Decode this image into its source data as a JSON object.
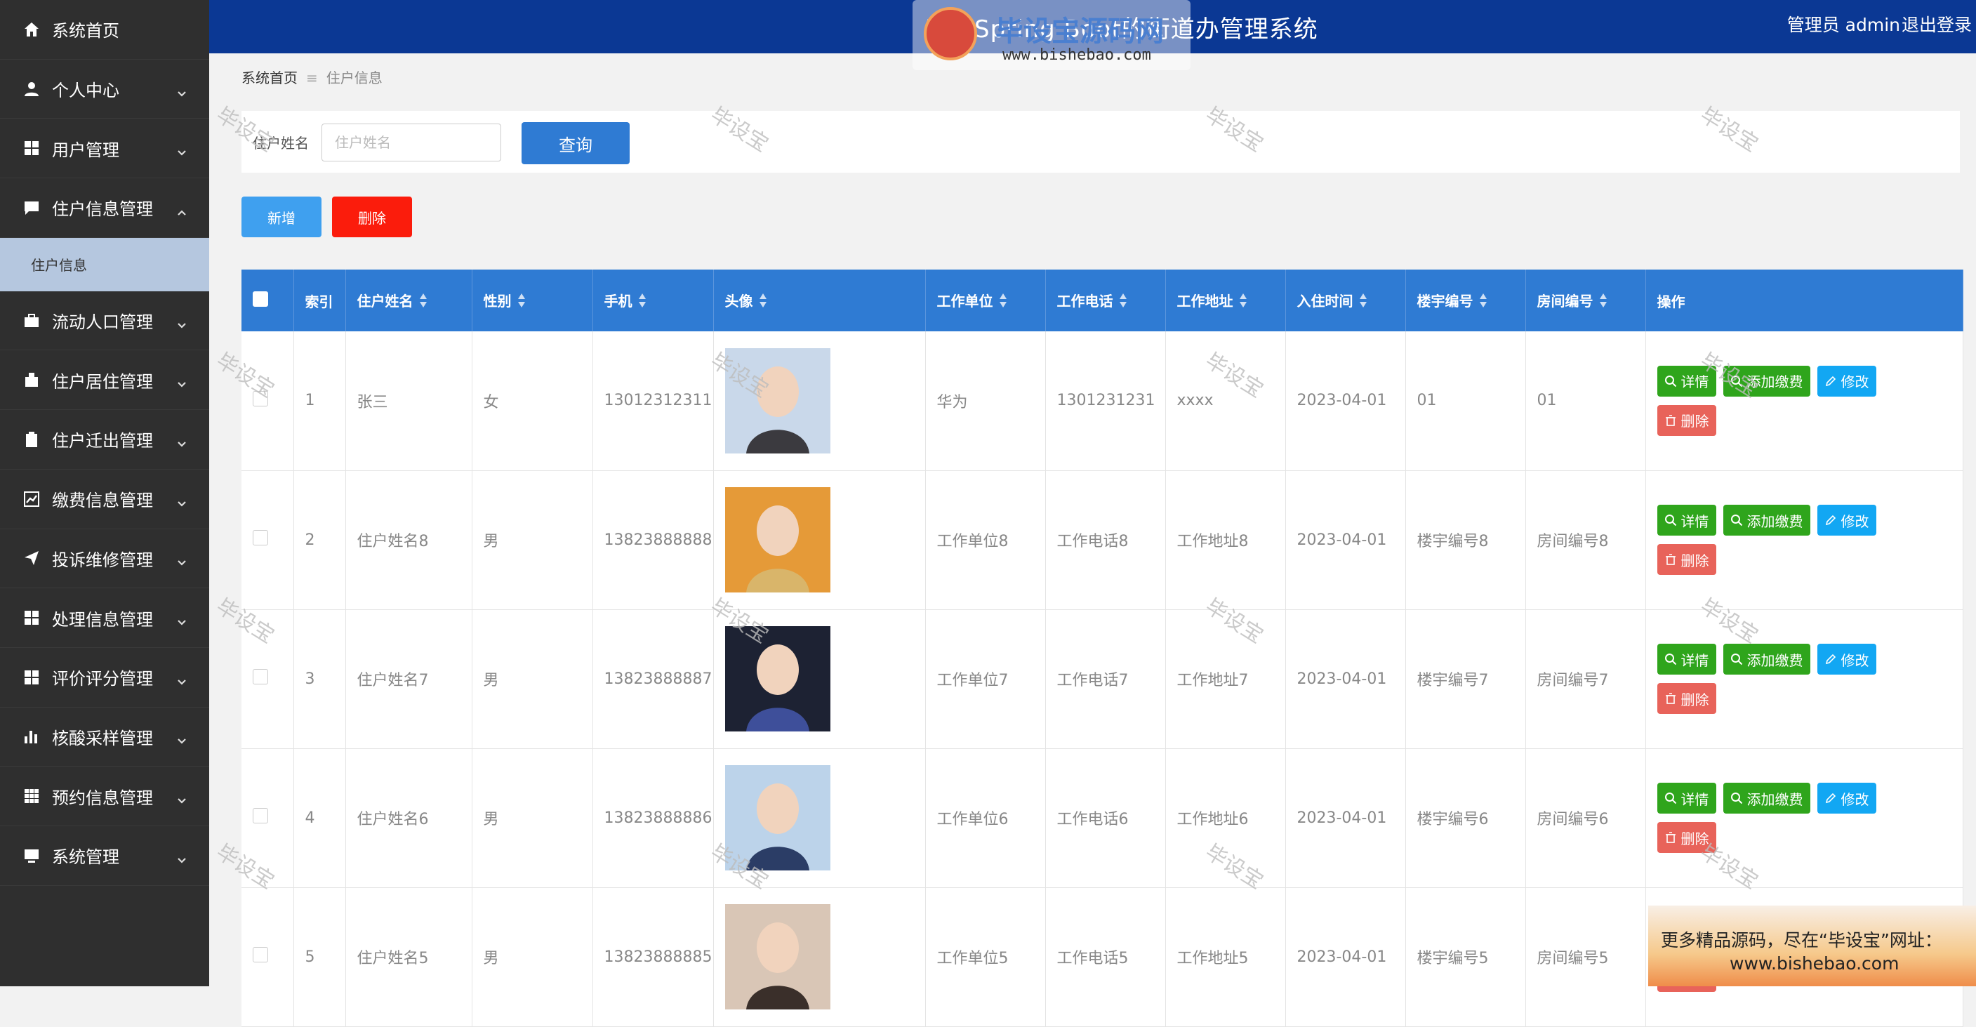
{
  "header": {
    "title": "基于Spring Boot的街道办管理系统",
    "admin": "管理员 admin",
    "logout": "退出登录",
    "logo_text": "毕设宝源码网",
    "logo_url": "www.bishebao.com"
  },
  "sidebar": {
    "items": [
      {
        "label": "系统首页",
        "icon": "home-icon"
      },
      {
        "label": "个人中心",
        "icon": "user-icon"
      },
      {
        "label": "用户管理",
        "icon": "grid-icon"
      },
      {
        "label": "住户信息管理",
        "icon": "chat-icon"
      },
      {
        "label": "流动人口管理",
        "icon": "briefcase-icon"
      },
      {
        "label": "住户居住管理",
        "icon": "bookmark-icon"
      },
      {
        "label": "住户迁出管理",
        "icon": "clipboard-icon"
      },
      {
        "label": "缴费信息管理",
        "icon": "chart-line-icon"
      },
      {
        "label": "投诉维修管理",
        "icon": "send-icon"
      },
      {
        "label": "处理信息管理",
        "icon": "grid-icon"
      },
      {
        "label": "评价评分管理",
        "icon": "grid-icon"
      },
      {
        "label": "核酸采样管理",
        "icon": "bar-chart-icon"
      },
      {
        "label": "预约信息管理",
        "icon": "table-icon"
      },
      {
        "label": "系统管理",
        "icon": "monitor-icon"
      }
    ],
    "sub_item": "住户信息"
  },
  "breadcrumb": {
    "home": "系统首页",
    "current": "住户信息"
  },
  "search": {
    "label": "住户姓名",
    "placeholder": "住户姓名",
    "button": "查询"
  },
  "actions": {
    "add": "新增",
    "delete": "删除"
  },
  "table": {
    "headers": [
      "索引",
      "住户姓名",
      "性别",
      "手机",
      "头像",
      "工作单位",
      "工作电话",
      "工作地址",
      "入住时间",
      "楼宇编号",
      "房间编号",
      "操作"
    ],
    "op_labels": {
      "detail": "详情",
      "pay": "添加缴费",
      "edit": "修改",
      "delete": "删除"
    },
    "rows": [
      {
        "index": "1",
        "name": "张三",
        "gender": "女",
        "phone": "13012312311",
        "company": "华为",
        "work_phone": "1301231231",
        "address": "xxxx",
        "date": "2023-04-01",
        "building": "01",
        "room": "01"
      },
      {
        "index": "2",
        "name": "住户姓名8",
        "gender": "男",
        "phone": "13823888888",
        "company": "工作单位8",
        "work_phone": "工作电话8",
        "address": "工作地址8",
        "date": "2023-04-01",
        "building": "楼宇编号8",
        "room": "房间编号8"
      },
      {
        "index": "3",
        "name": "住户姓名7",
        "gender": "男",
        "phone": "13823888887",
        "company": "工作单位7",
        "work_phone": "工作电话7",
        "address": "工作地址7",
        "date": "2023-04-01",
        "building": "楼宇编号7",
        "room": "房间编号7"
      },
      {
        "index": "4",
        "name": "住户姓名6",
        "gender": "男",
        "phone": "13823888886",
        "company": "工作单位6",
        "work_phone": "工作电话6",
        "address": "工作地址6",
        "date": "2023-04-01",
        "building": "楼宇编号6",
        "room": "房间编号6"
      },
      {
        "index": "5",
        "name": "住户姓名5",
        "gender": "男",
        "phone": "13823888885",
        "company": "工作单位5",
        "work_phone": "工作电话5",
        "address": "工作地址5",
        "date": "2023-04-01",
        "building": "楼宇编号5",
        "room": "房间编号5"
      }
    ]
  },
  "watermark": "毕设宝",
  "ad": {
    "line1": "更多精品源码，尽在“毕设宝”网址：",
    "line2": "www.bishebao.com"
  },
  "colors": {
    "header_bg": "#0b3894",
    "sidebar_bg": "#2f2f2f",
    "table_header_bg": "#2f7bd3",
    "add_btn": "#3fa0ef",
    "delete_btn": "#fb1c0c",
    "detail_btn": "#2fa51c",
    "edit_btn": "#12a7f3",
    "row_delete_btn": "#e8635a"
  }
}
